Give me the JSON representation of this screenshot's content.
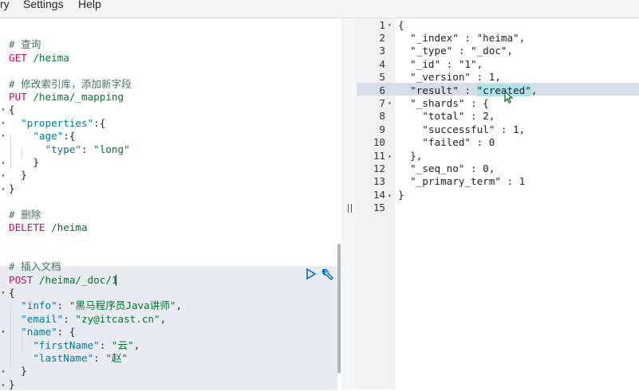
{
  "menu": {
    "items": [
      "ry",
      "Settings",
      "Help"
    ]
  },
  "editor": {
    "lines": [
      {
        "fold": "",
        "parts": [
          [
            "",
            ""
          ]
        ]
      },
      {
        "fold": "",
        "parts": [
          [
            "cmt",
            "# 查询"
          ]
        ]
      },
      {
        "fold": "",
        "parts": [
          [
            "meth",
            "GET"
          ],
          [
            "url",
            " /heima"
          ]
        ]
      },
      {
        "fold": "",
        "parts": [
          [
            "",
            ""
          ]
        ]
      },
      {
        "fold": "",
        "parts": [
          [
            "cmt",
            "# 修改索引库，添加新字段"
          ]
        ]
      },
      {
        "fold": "",
        "parts": [
          [
            "meth",
            "PUT"
          ],
          [
            "url",
            " /heima/_mapping"
          ]
        ]
      },
      {
        "fold": "▾",
        "parts": [
          [
            "pun",
            "{"
          ]
        ]
      },
      {
        "fold": "▾",
        "parts": [
          [
            "pun",
            "  "
          ],
          [
            "key",
            "\"properties\""
          ],
          [
            "pun",
            ":{"
          ]
        ]
      },
      {
        "fold": "▾",
        "parts": [
          [
            "pun",
            "    "
          ],
          [
            "key",
            "\"age\""
          ],
          [
            "pun",
            ":{"
          ]
        ]
      },
      {
        "fold": "",
        "parts": [
          [
            "pun",
            "      "
          ],
          [
            "key",
            "\"type\""
          ],
          [
            "pun",
            ": "
          ],
          [
            "str",
            "\"long\""
          ]
        ]
      },
      {
        "fold": "▴",
        "parts": [
          [
            "pun",
            "    }"
          ]
        ]
      },
      {
        "fold": "▴",
        "parts": [
          [
            "pun",
            "  }"
          ]
        ]
      },
      {
        "fold": "▴",
        "parts": [
          [
            "pun",
            "}"
          ]
        ]
      },
      {
        "fold": "",
        "parts": [
          [
            "",
            ""
          ]
        ]
      },
      {
        "fold": "",
        "parts": [
          [
            "cmt",
            "# 删除"
          ]
        ]
      },
      {
        "fold": "",
        "parts": [
          [
            "meth",
            "DELETE"
          ],
          [
            "url",
            " /heima"
          ]
        ]
      },
      {
        "fold": "",
        "parts": [
          [
            "",
            ""
          ]
        ]
      },
      {
        "fold": "",
        "parts": [
          [
            "",
            ""
          ]
        ]
      },
      {
        "fold": "",
        "parts": [
          [
            "cmt",
            "# 插入文档"
          ]
        ]
      },
      {
        "fold": "",
        "parts": [
          [
            "meth",
            "POST"
          ],
          [
            "url",
            " /heima/_doc/1"
          ]
        ]
      },
      {
        "fold": "▾",
        "parts": [
          [
            "pun",
            "{"
          ]
        ]
      },
      {
        "fold": "",
        "parts": [
          [
            "pun",
            "  "
          ],
          [
            "key",
            "\"info\""
          ],
          [
            "pun",
            ": "
          ],
          [
            "str",
            "\"黑马程序员Java讲师\""
          ],
          [
            "pun",
            ","
          ]
        ]
      },
      {
        "fold": "",
        "parts": [
          [
            "pun",
            "  "
          ],
          [
            "key",
            "\"email\""
          ],
          [
            "pun",
            ": "
          ],
          [
            "str",
            "\"zy@itcast.cn\""
          ],
          [
            "pun",
            ","
          ]
        ]
      },
      {
        "fold": "▾",
        "parts": [
          [
            "pun",
            "  "
          ],
          [
            "key",
            "\"name\""
          ],
          [
            "pun",
            ": {"
          ]
        ]
      },
      {
        "fold": "",
        "parts": [
          [
            "pun",
            "    "
          ],
          [
            "key",
            "\"firstName\""
          ],
          [
            "pun",
            ": "
          ],
          [
            "str",
            "\"云\""
          ],
          [
            "pun",
            ","
          ]
        ]
      },
      {
        "fold": "",
        "parts": [
          [
            "pun",
            "    "
          ],
          [
            "key",
            "\"lastName\""
          ],
          [
            "pun",
            ": "
          ],
          [
            "str",
            "\"赵\""
          ]
        ]
      },
      {
        "fold": "▴",
        "parts": [
          [
            "pun",
            "  }"
          ]
        ]
      },
      {
        "fold": "▴",
        "parts": [
          [
            "pun",
            "}"
          ]
        ]
      }
    ],
    "run_icon": "play-icon",
    "wrench_icon": "wrench-icon"
  },
  "response": {
    "lines": [
      {
        "n": "1",
        "fold": "▾",
        "code": "{"
      },
      {
        "n": "2",
        "fold": "",
        "code": "  \"_index\" : \"heima\","
      },
      {
        "n": "3",
        "fold": "",
        "code": "  \"_type\" : \"_doc\","
      },
      {
        "n": "4",
        "fold": "",
        "code": "  \"_id\" : \"1\","
      },
      {
        "n": "5",
        "fold": "",
        "code": "  \"_version\" : 1,"
      },
      {
        "n": "6",
        "fold": "",
        "code": "  \"result\" : \"created\","
      },
      {
        "n": "7",
        "fold": "▾",
        "code": "  \"_shards\" : {"
      },
      {
        "n": "8",
        "fold": "",
        "code": "    \"total\" : 2,"
      },
      {
        "n": "9",
        "fold": "",
        "code": "    \"successful\" : 1,"
      },
      {
        "n": "10",
        "fold": "",
        "code": "    \"failed\" : 0"
      },
      {
        "n": "11",
        "fold": "▴",
        "code": "  },"
      },
      {
        "n": "12",
        "fold": "",
        "code": "  \"_seq_no\" : 0,"
      },
      {
        "n": "13",
        "fold": "",
        "code": "  \"_primary_term\" : 1"
      },
      {
        "n": "14",
        "fold": "▴",
        "code": "}"
      },
      {
        "n": "15",
        "fold": "",
        "code": ""
      }
    ],
    "selected_text": "\"created\""
  }
}
